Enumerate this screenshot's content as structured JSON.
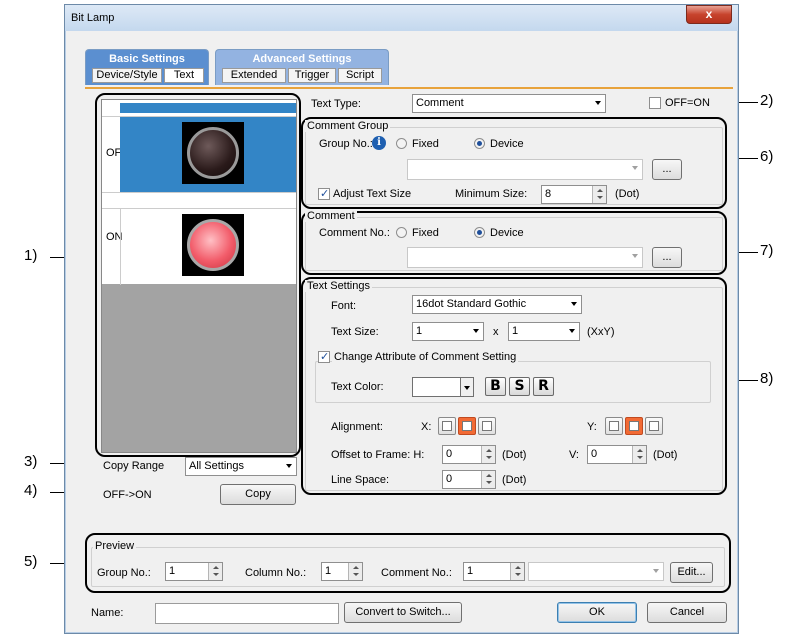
{
  "window": {
    "title": "Bit Lamp",
    "close_label": "x"
  },
  "tabs": {
    "basic": {
      "label": "Basic Settings",
      "sub": [
        "Device/Style",
        "Text"
      ]
    },
    "advanced": {
      "label": "Advanced Settings",
      "sub": [
        "Extended",
        "Trigger",
        "Script"
      ]
    }
  },
  "preview_states": {
    "off": "OFF",
    "on": "ON"
  },
  "copy": {
    "range_label": "Copy Range",
    "range_value": "All Settings",
    "direction": "OFF->ON",
    "button": "Copy"
  },
  "text_type": {
    "label": "Text Type:",
    "value": "Comment",
    "off_on_label": "OFF=ON"
  },
  "comment_group": {
    "title": "Comment Group",
    "group_no_label": "Group No.:",
    "fixed_label": "Fixed",
    "device_label": "Device",
    "device_value": "",
    "browse": "...",
    "adjust_label": "Adjust Text Size",
    "min_size_label": "Minimum Size:",
    "min_size_value": "8",
    "unit": "(Dot)"
  },
  "comment": {
    "title": "Comment",
    "comment_no_label": "Comment No.:",
    "fixed_label": "Fixed",
    "device_label": "Device",
    "device_value": "",
    "browse": "..."
  },
  "text_settings": {
    "title": "Text Settings",
    "font_label": "Font:",
    "font_value": "16dot Standard Gothic",
    "size_label": "Text Size:",
    "size_x": "1",
    "size_sep": "x",
    "size_y": "1",
    "size_unit": "(XxY)",
    "change_attr_label": "Change Attribute of Comment Setting",
    "color_label": "Text Color:",
    "bold": "B",
    "shadow": "S",
    "raised": "R",
    "alignment_label": "Alignment:",
    "x_label": "X:",
    "y_label": "Y:",
    "offset_label": "Offset to Frame: H:",
    "offset_h": "0",
    "offset_v_label": "V:",
    "offset_v": "0",
    "line_space_label": "Line Space:",
    "line_space": "0",
    "unit": "(Dot)"
  },
  "preview": {
    "title": "Preview",
    "group_label": "Group No.:",
    "group_value": "1",
    "column_label": "Column No.:",
    "column_value": "1",
    "comment_label": "Comment No.:",
    "comment_value": "1",
    "edit": "Edit..."
  },
  "footer": {
    "name_label": "Name:",
    "name_value": "",
    "convert": "Convert to Switch...",
    "ok": "OK",
    "cancel": "Cancel"
  },
  "callouts": [
    "1)",
    "2)",
    "3)",
    "4)",
    "5)",
    "6)",
    "7)",
    "8)"
  ],
  "colors": {
    "accent_orange": "#e8a33c",
    "selection_blue": "#3385c6",
    "tab_blue": "#5b8fd0",
    "lamp_on": "#f25c6a"
  }
}
